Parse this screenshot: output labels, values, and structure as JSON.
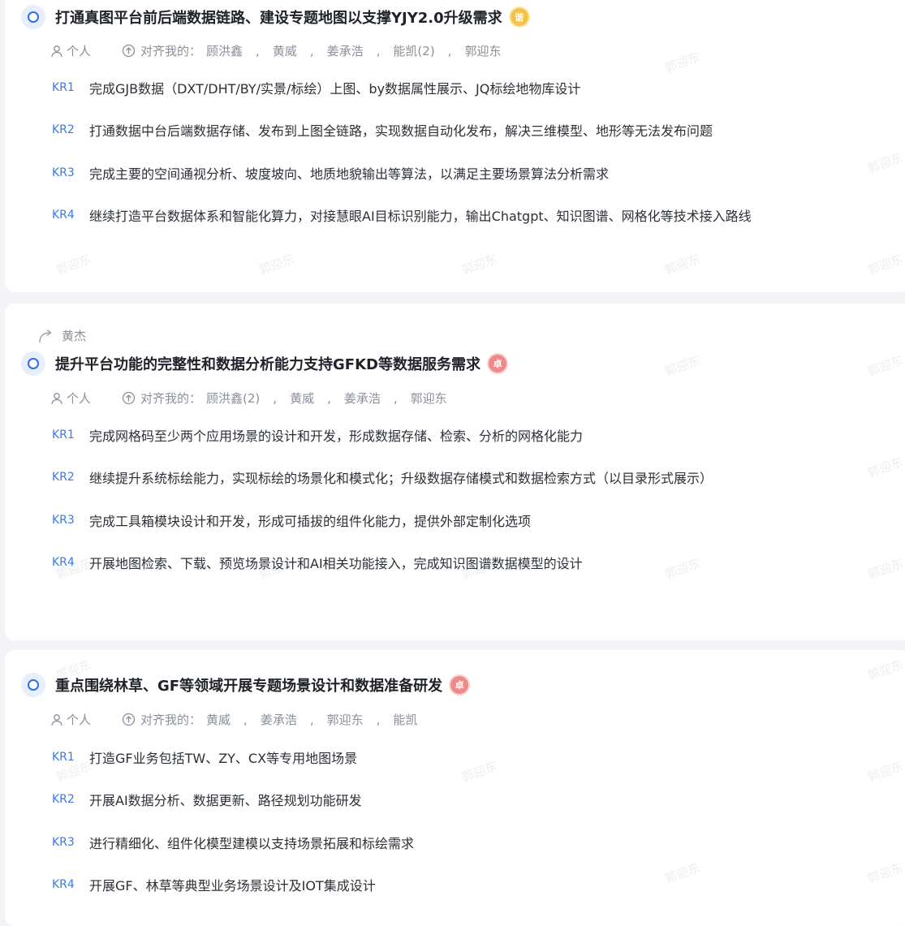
{
  "watermark": "郭迎东",
  "objectives": [
    {
      "parent": "",
      "title": "打通真图平台前后端数据链路、建设专题地图以支撑YJY2.0升级需求",
      "badge": {
        "text": "谐",
        "color": "#f3c24a"
      },
      "owner_type": "个人",
      "align_label": "对齐我的：",
      "aligned": [
        "顾洪鑫",
        "黄威",
        "姜承浩",
        "能凯(2)",
        "郭迎东"
      ],
      "krs": [
        {
          "label": "KR1",
          "text": "完成GJB数据（DXT/DHT/BY/实景/标绘）上图、by数据属性展示、JQ标绘地物库设计"
        },
        {
          "label": "KR2",
          "text": "打通数据中台后端数据存储、发布到上图全链路，实现数据自动化发布，解决三维模型、地形等无法发布问题"
        },
        {
          "label": "KR3",
          "text": "完成主要的空间通视分析、坡度坡向、地质地貌输出等算法，以满足主要场景算法分析需求"
        },
        {
          "label": "KR4",
          "text": "继续打造平台数据体系和智能化算力，对接慧眼AI目标识别能力，输出Chatgpt、知识图谱、网格化等技术接入路线"
        }
      ]
    },
    {
      "parent": "黄杰",
      "title": "提升平台功能的完整性和数据分析能力支持GFKD等数据服务需求",
      "badge": {
        "text": "卓",
        "color": "#ef8a8a"
      },
      "owner_type": "个人",
      "align_label": "对齐我的：",
      "aligned": [
        "顾洪鑫(2)",
        "黄威",
        "姜承浩",
        "郭迎东"
      ],
      "krs": [
        {
          "label": "KR1",
          "text": "完成网格码至少两个应用场景的设计和开发，形成数据存储、检索、分析的网格化能力"
        },
        {
          "label": "KR2",
          "text": "继续提升系统标绘能力，实现标绘的场景化和模式化；升级数据存储模式和数据检索方式（以目录形式展示）"
        },
        {
          "label": "KR3",
          "text": "完成工具箱模块设计和开发，形成可插拔的组件化能力，提供外部定制化选项"
        },
        {
          "label": "KR4",
          "text": "开展地图检索、下载、预览场景设计和AI相关功能接入，完成知识图谱数据模型的设计"
        }
      ]
    },
    {
      "parent": "",
      "title": "重点围绕林草、GF等领域开展专题场景设计和数据准备研发",
      "badge": {
        "text": "卓",
        "color": "#ef8a8a"
      },
      "owner_type": "个人",
      "align_label": "对齐我的：",
      "aligned": [
        "黄威",
        "姜承浩",
        "郭迎东",
        "能凯"
      ],
      "krs": [
        {
          "label": "KR1",
          "text": "打造GF业务包括TW、ZY、CX等专用地图场景"
        },
        {
          "label": "KR2",
          "text": "开展AI数据分析、数据更新、路径规划功能研发"
        },
        {
          "label": "KR3",
          "text": "进行精细化、组件化模型建模以支持场景拓展和标绘需求"
        },
        {
          "label": "KR4",
          "text": "开展GF、林草等典型业务场景设计及IOT集成设计"
        }
      ]
    }
  ]
}
